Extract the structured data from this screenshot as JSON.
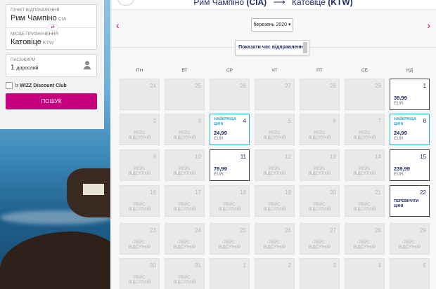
{
  "search": {
    "departure_label": "ПУНКТ ВІДПРАВЛЕННЯ",
    "departure_value": "Рим Чампіно",
    "departure_code": "CIA",
    "destination_label": "МІСЦЕ ПРИЗНАЧЕННЯ",
    "destination_value": "Катовіце",
    "destination_code": "KTW",
    "swap_symbol": "⇄",
    "passengers_label": "ПАСАЖИРИ",
    "passengers_count": "1",
    "passengers_unit": "дорослий",
    "discount_prefix": "Із",
    "discount_name": "WIZZ Discount Club",
    "search_button": "ПОШУК"
  },
  "header": {
    "from": "Рим Чампіно",
    "from_code": "(CIA)",
    "arrow": "⟶",
    "to": "Катовіце",
    "to_code": "(KTW)"
  },
  "calendar": {
    "prev": "‹",
    "next": "›",
    "month": "березень 2020",
    "month_caret": "▾",
    "show_times": "Показати час відправлення",
    "weekdays": [
      "ПН",
      "ВТ",
      "СР",
      "ЧТ",
      "ПТ",
      "СБ",
      "НД"
    ],
    "no_flight": [
      "РЕЙС",
      "ВІДСУТНІЙ"
    ],
    "currency": "EUR",
    "best_price": [
      "НАЙКРАЩА",
      "ЦІНА"
    ],
    "check_prices": [
      "ПЕРЕВІРИТИ",
      "ЦІНИ"
    ],
    "weeks": [
      [
        {
          "day": "24",
          "state": "past"
        },
        {
          "day": "25",
          "state": "past"
        },
        {
          "day": "26",
          "state": "past"
        },
        {
          "day": "27",
          "state": "past"
        },
        {
          "day": "28",
          "state": "past"
        },
        {
          "day": "29",
          "state": "past"
        },
        {
          "day": "1",
          "state": "avail",
          "price": "39,99"
        }
      ],
      [
        {
          "day": "2",
          "state": "none"
        },
        {
          "day": "3",
          "state": "none"
        },
        {
          "day": "4",
          "state": "best",
          "price": "24,99"
        },
        {
          "day": "5",
          "state": "none"
        },
        {
          "day": "6",
          "state": "none"
        },
        {
          "day": "7",
          "state": "none"
        },
        {
          "day": "8",
          "state": "best",
          "price": "24,99"
        }
      ],
      [
        {
          "day": "9",
          "state": "none"
        },
        {
          "day": "10",
          "state": "none"
        },
        {
          "day": "11",
          "state": "avail",
          "price": "79,99"
        },
        {
          "day": "12",
          "state": "none"
        },
        {
          "day": "13",
          "state": "none"
        },
        {
          "day": "14",
          "state": "none"
        },
        {
          "day": "15",
          "state": "avail",
          "price": "239,99"
        }
      ],
      [
        {
          "day": "16",
          "state": "none"
        },
        {
          "day": "17",
          "state": "none"
        },
        {
          "day": "18",
          "state": "none"
        },
        {
          "day": "19",
          "state": "none"
        },
        {
          "day": "20",
          "state": "none"
        },
        {
          "day": "21",
          "state": "none"
        },
        {
          "day": "22",
          "state": "check"
        }
      ],
      [
        {
          "day": "23",
          "state": "none"
        },
        {
          "day": "24",
          "state": "none"
        },
        {
          "day": "25",
          "state": "none"
        },
        {
          "day": "26",
          "state": "none"
        },
        {
          "day": "27",
          "state": "none"
        },
        {
          "day": "28",
          "state": "none"
        },
        {
          "day": "29",
          "state": "none"
        }
      ],
      [
        {
          "day": "30",
          "state": "none"
        },
        {
          "day": "31",
          "state": "none"
        },
        {
          "day": "1",
          "state": "past"
        },
        {
          "day": "2",
          "state": "past"
        },
        {
          "day": "3",
          "state": "past"
        },
        {
          "day": "4",
          "state": "past"
        },
        {
          "day": "5",
          "state": "past"
        }
      ]
    ]
  },
  "colors": {
    "brand": "#c6007e",
    "navy": "#1f2a6b",
    "best": "#2ba6d6"
  }
}
